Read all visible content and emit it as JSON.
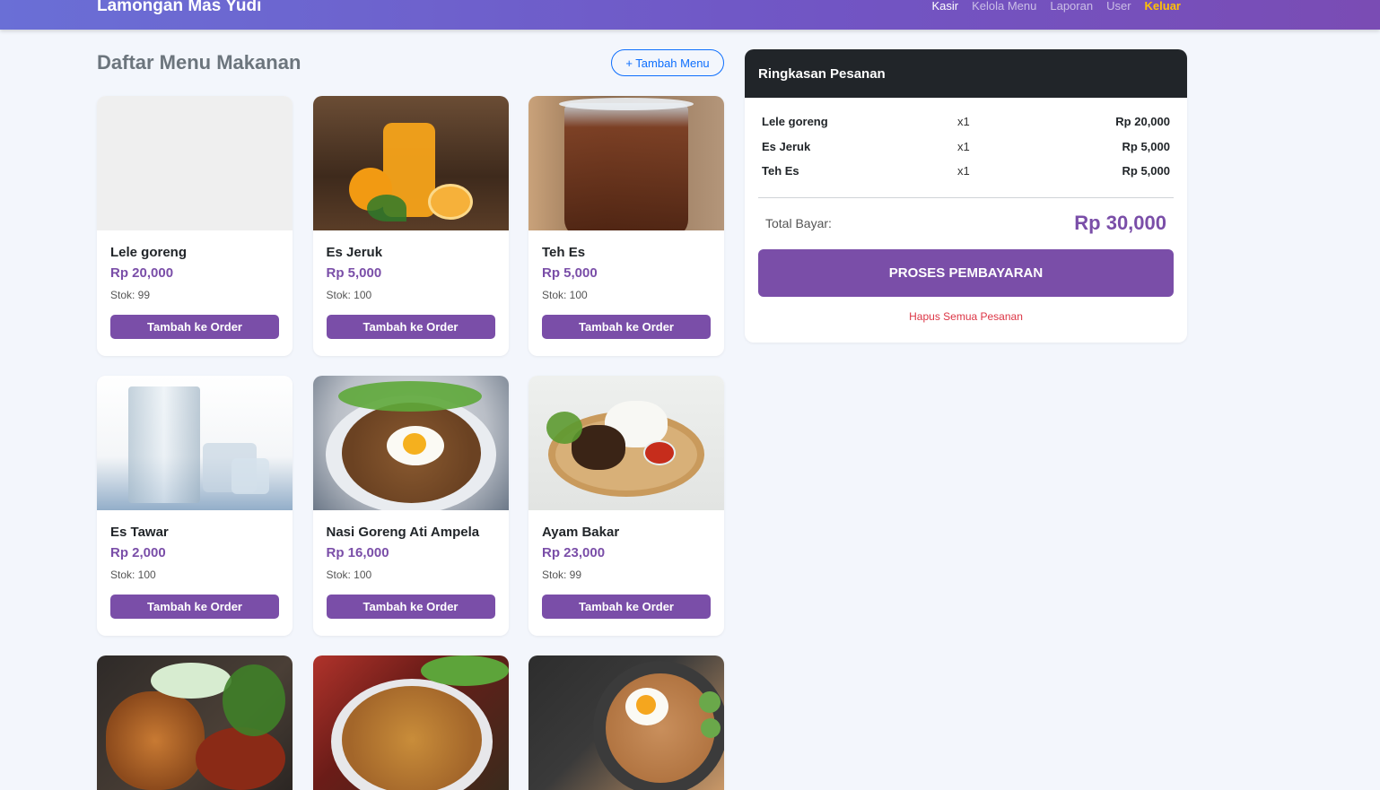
{
  "navbar": {
    "brand": "Lamongan Mas Yudi",
    "items": [
      "Kasir",
      "Kelola Menu",
      "Laporan",
      "User"
    ],
    "logout": "Keluar"
  },
  "page": {
    "title": "Daftar Menu Makanan",
    "add_button": "+ Tambah Menu"
  },
  "menu_button_label": "Tambah ke Order",
  "menu": [
    {
      "name": "Lele goreng",
      "price": "Rp 20,000",
      "stock": "Stok: 99"
    },
    {
      "name": "Es Jeruk",
      "price": "Rp 5,000",
      "stock": "Stok: 100"
    },
    {
      "name": "Teh Es",
      "price": "Rp 5,000",
      "stock": "Stok: 100"
    },
    {
      "name": "Es Tawar",
      "price": "Rp 2,000",
      "stock": "Stok: 100"
    },
    {
      "name": "Nasi Goreng Ati Ampela",
      "price": "Rp 16,000",
      "stock": "Stok: 100"
    },
    {
      "name": "Ayam Bakar",
      "price": "Rp 23,000",
      "stock": "Stok: 99"
    }
  ],
  "summary": {
    "title": "Ringkasan Pesanan",
    "orders": [
      {
        "name": "Lele goreng",
        "qty": "x1",
        "subtotal": "Rp 20,000"
      },
      {
        "name": "Es Jeruk",
        "qty": "x1",
        "subtotal": "Rp 5,000"
      },
      {
        "name": "Teh Es",
        "qty": "x1",
        "subtotal": "Rp 5,000"
      }
    ],
    "total_label": "Total Bayar:",
    "total_value": "Rp 30,000",
    "pay_button": "PROSES PEMBAYARAN",
    "clear_link": "Hapus Semua Pesanan"
  },
  "colors": {
    "accent": "#7a4ea8",
    "navbar_start": "#6a6fd6",
    "navbar_end": "#7a4cb4",
    "logout": "#ffc107",
    "danger": "#dc3545",
    "link": "#0d6efd"
  }
}
